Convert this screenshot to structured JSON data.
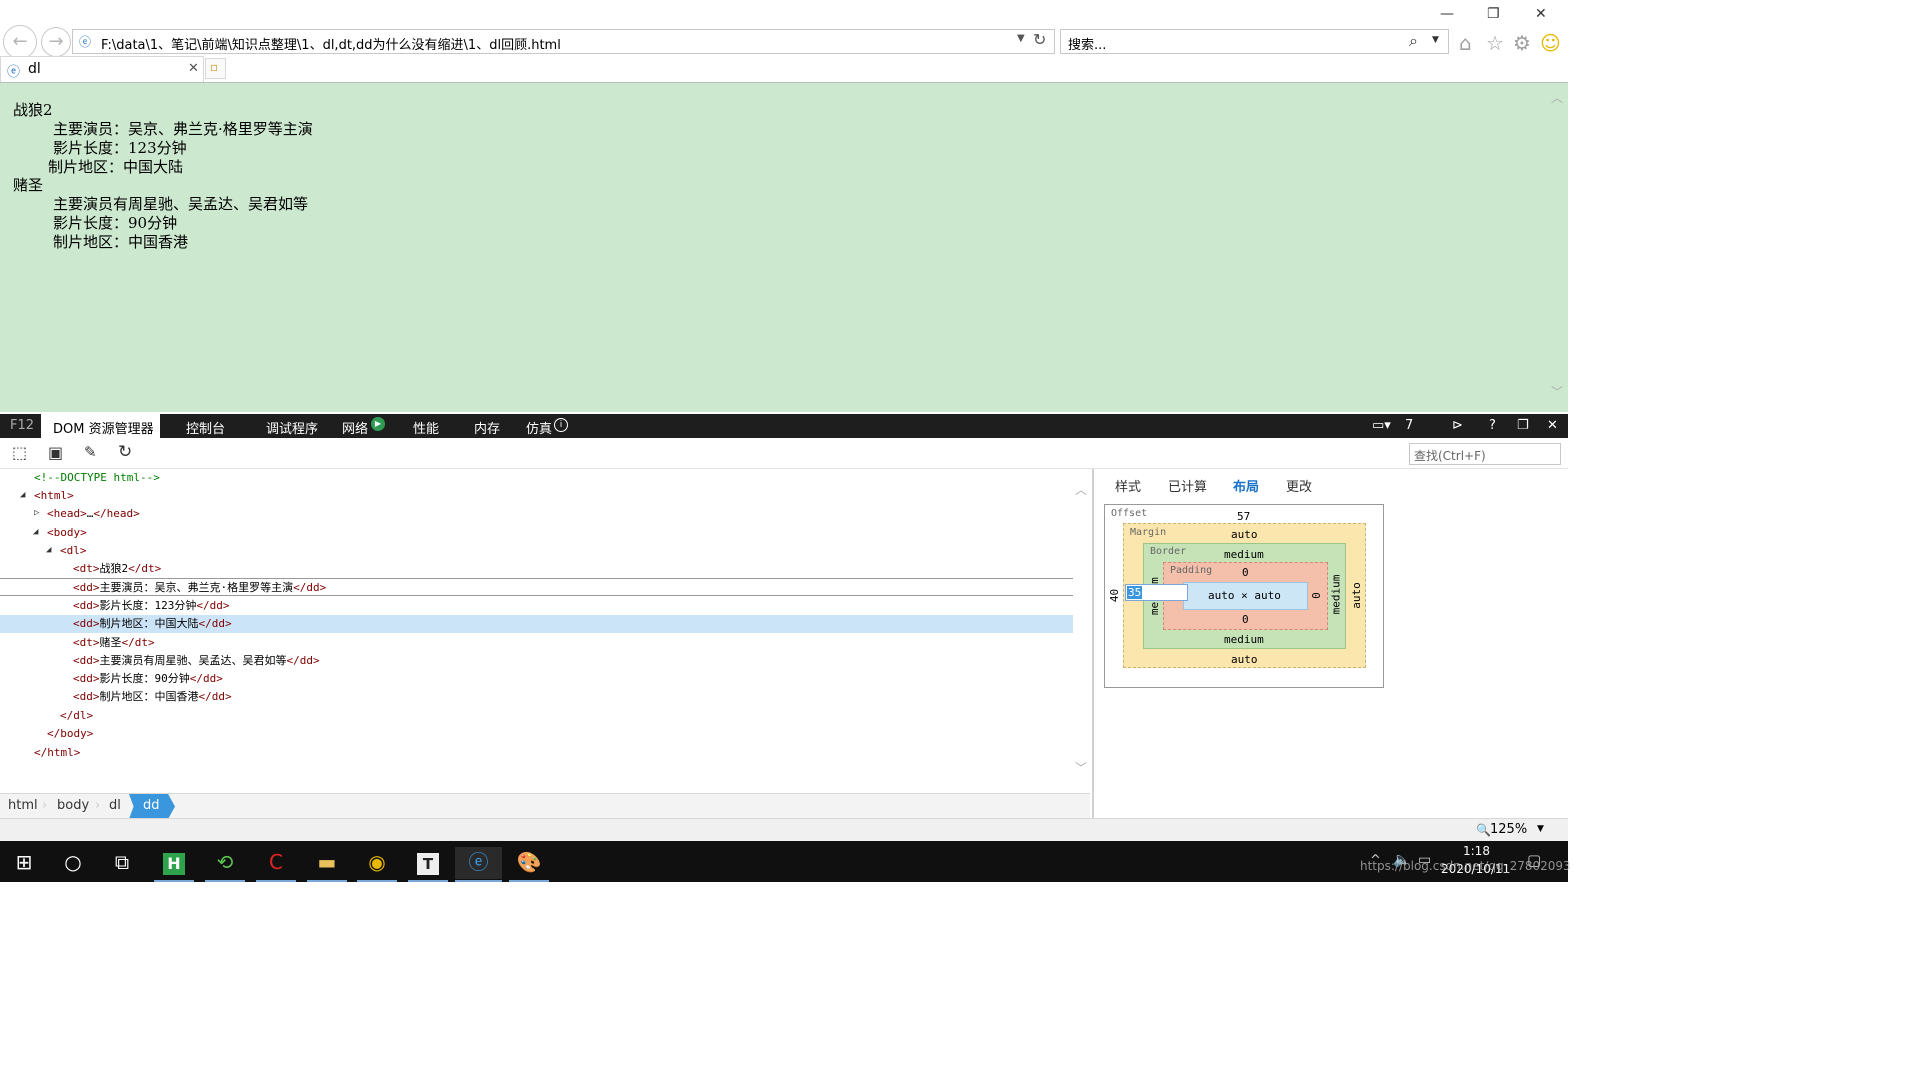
{
  "window": {
    "minimize": "—",
    "restore": "❐",
    "close": "✕"
  },
  "address": {
    "url": "F:\\data\\1、笔记\\前端\\知识点整理\\1、dl,dt,dd为什么没有缩进\\1、dl回顾.html"
  },
  "search": {
    "placeholder": "搜索..."
  },
  "tab": {
    "title": "dl"
  },
  "page": {
    "dl": [
      {
        "dt": "战狼2",
        "dd": [
          "主要演员：吴京、弗兰克·格里罗等主演",
          "影片长度：123分钟",
          "制片地区：中国大陆"
        ]
      },
      {
        "dt": "赌圣",
        "dd": [
          "主要演员有周星驰、吴孟达、吴君如等",
          "影片长度：90分钟",
          "制片地区：中国香港"
        ]
      }
    ]
  },
  "devtools": {
    "f12": "F12",
    "tabs": [
      "DOM 资源管理器",
      "控制台",
      "调试程序",
      "网络",
      "性能",
      "内存",
      "仿真"
    ],
    "target_count": "7",
    "find_placeholder": "查找(Ctrl+F)",
    "dom_lines": [
      {
        "comment": "<!--DOCTYPE html-->"
      },
      {
        "open": "<html>"
      },
      {
        "open": "<head>",
        "mid": "…",
        "close": "</head>"
      },
      {
        "open": "<body>"
      },
      {
        "open": "<dl>"
      },
      {
        "open": "<dt>",
        "mid": "战狼2",
        "close": "</dt>"
      },
      {
        "open": "<dd>",
        "mid": "主要演员：吴京、弗兰克·格里罗等主演",
        "close": "</dd>"
      },
      {
        "open": "<dd>",
        "mid": "影片长度：123分钟",
        "close": "</dd>"
      },
      {
        "open": "<dd>",
        "mid": "制片地区：中国大陆",
        "close": "</dd>"
      },
      {
        "open": "<dt>",
        "mid": "赌圣",
        "close": "</dt>"
      },
      {
        "open": "<dd>",
        "mid": "主要演员有周星驰、吴孟达、吴君如等",
        "close": "</dd>"
      },
      {
        "open": "<dd>",
        "mid": "影片长度：90分钟",
        "close": "</dd>"
      },
      {
        "open": "<dd>",
        "mid": "制片地区：中国香港",
        "close": "</dd>"
      },
      {
        "open": "</dl>"
      },
      {
        "open": "</body>"
      },
      {
        "open": "</html>"
      }
    ],
    "breadcrumb": [
      "html",
      "body",
      "dl",
      "dd"
    ],
    "right_tabs": [
      "样式",
      "已计算",
      "布局",
      "更改"
    ],
    "box": {
      "offset_label": "Offset",
      "offset_top": "57",
      "offset_left": "40",
      "margin_label": "Margin",
      "margin_top": "auto",
      "margin_bottom": "auto",
      "margin_right": "auto",
      "margin_left_edit": "35",
      "border_label": "Border",
      "border_top": "medium",
      "border_bottom": "medium",
      "border_right": "medium",
      "border_left_frag_top": "m",
      "border_left_frag_bottom": "me",
      "padding_label": "Padding",
      "padding_top": "0",
      "padding_bottom": "0",
      "padding_right": "0",
      "content": "auto × auto"
    }
  },
  "status": {
    "zoom": "125%"
  },
  "taskbar": {
    "time": "1:18",
    "date": "2020/10/11",
    "watermark": "https://blog.csdn.net/qq_27802093"
  }
}
